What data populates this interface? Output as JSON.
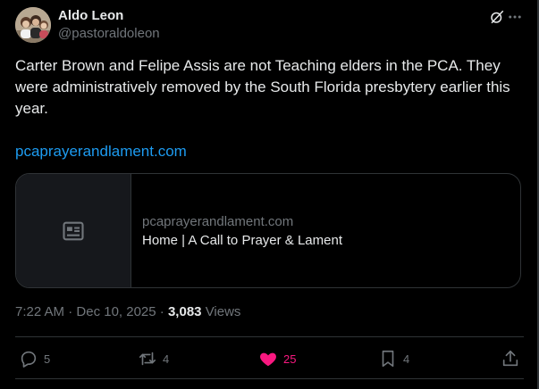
{
  "author": {
    "name": "Aldo Leon",
    "handle": "@pastoraldoleon",
    "avatar_icon": "profile-photo"
  },
  "header_actions": {
    "grok_icon": "grok-icon",
    "more_icon": "more-horizontal-icon"
  },
  "tweet": {
    "text": "Carter Brown and Felipe Assis are not Teaching elders in the PCA. They were administratively removed by the South Florida presbytery earlier this year.",
    "link": "pcaprayerandlament.com"
  },
  "card": {
    "thumb_icon": "article-icon",
    "domain": "pcaprayerandlament.com",
    "title": "Home | A Call to Prayer & Lament"
  },
  "meta": {
    "time": "7:22 AM",
    "separator1": "·",
    "date": "Dec 10, 2025",
    "separator2": "·",
    "views_count": "3,083",
    "views_label": "Views"
  },
  "actions": {
    "reply": {
      "icon": "reply-icon",
      "count": "5"
    },
    "repost": {
      "icon": "repost-icon",
      "count": "4"
    },
    "like": {
      "icon": "heart-icon",
      "count": "25",
      "liked": true
    },
    "bookmark": {
      "icon": "bookmark-icon",
      "count": "4"
    },
    "share": {
      "icon": "share-icon"
    }
  },
  "colors": {
    "background": "#000000",
    "text": "#e7e9ea",
    "secondary": "#71767b",
    "link": "#1d9bf0",
    "like": "#f91880",
    "border": "#2f3336"
  }
}
